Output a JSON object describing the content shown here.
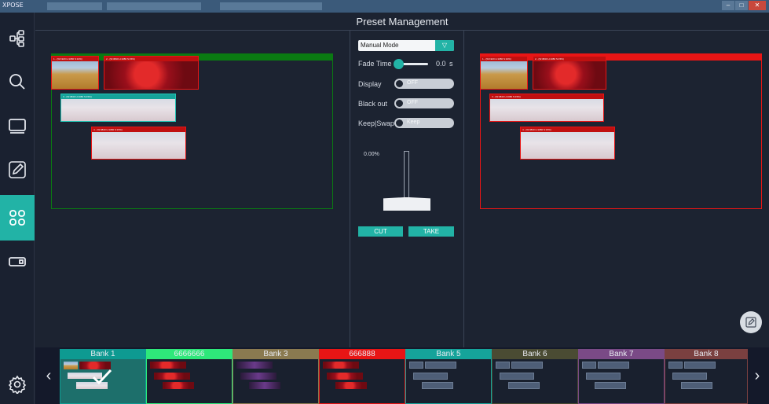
{
  "window": {
    "app_name": "XPOSE"
  },
  "page": {
    "title": "Preset Management"
  },
  "sidebar": {
    "items": [
      {
        "icon": "topology-icon",
        "active": false
      },
      {
        "icon": "search-icon",
        "active": false
      },
      {
        "icon": "monitor-icon",
        "active": false
      },
      {
        "icon": "edit-icon",
        "active": false
      },
      {
        "icon": "preset-grid-icon",
        "active": true
      },
      {
        "icon": "output-icon",
        "active": false
      },
      {
        "icon": "settings-icon",
        "active": false
      }
    ]
  },
  "preview": {
    "color": "#0a7a12",
    "windows": [
      {
        "label": "1 - (W:1920 H:1080 S:10%)",
        "tile": "field"
      },
      {
        "label": "2 - (W:3840 H:1080 S:15%)",
        "tile": "apple"
      },
      {
        "label": "3 - (W:3840 H:1080 S:15%)",
        "tile": "fade"
      },
      {
        "label": "4 - (W:3840 H:1080 S:15%)",
        "tile": "fade"
      }
    ]
  },
  "program": {
    "color": "#e81515",
    "windows": [
      {
        "label": "1 - (W:1920 H:1080 S:10%)",
        "tile": "field"
      },
      {
        "label": "2 - (W:3840 H:1080 S:15%)",
        "tile": "apple"
      },
      {
        "label": "3 - (W:3840 H:1080 S:15%)",
        "tile": "fade"
      },
      {
        "label": "4 - (W:3840 H:1080 S:15%)",
        "tile": "fade"
      }
    ]
  },
  "controls": {
    "mode": "Manual Mode",
    "fade_time_label": "Fade Time",
    "fade_time_value": "0.0",
    "fade_time_unit": "s",
    "fade_time_fraction": 0.0,
    "display_label": "Display",
    "display_state": "OFF",
    "blackout_label": "Black out",
    "blackout_state": "OFF",
    "keepswap_label": "Keep|Swap",
    "keepswap_state": "Keep",
    "tbar_percent": "0.00%",
    "cut_label": "CUT",
    "take_label": "TAKE"
  },
  "banks": [
    {
      "name": "Bank 1",
      "color": "#0e9a91",
      "selected": true,
      "kind": "thumbs"
    },
    {
      "name": "6666666",
      "color": "#2ee87a",
      "selected": false,
      "kind": "apple"
    },
    {
      "name": "Bank 3",
      "color": "#8a7a50",
      "selected": false,
      "kind": "purple"
    },
    {
      "name": "666888",
      "color": "#e81515",
      "selected": false,
      "kind": "apple"
    },
    {
      "name": "Bank 5",
      "color": "#15a39a",
      "selected": false,
      "kind": "empty"
    },
    {
      "name": "Bank 6",
      "color": "#4a4b33",
      "selected": false,
      "kind": "empty"
    },
    {
      "name": "Bank 7",
      "color": "#7a4a86",
      "selected": false,
      "kind": "empty"
    },
    {
      "name": "Bank 8",
      "color": "#7a4040",
      "selected": false,
      "kind": "empty"
    }
  ],
  "bank_nav": {
    "prev": "‹",
    "next": "›"
  }
}
